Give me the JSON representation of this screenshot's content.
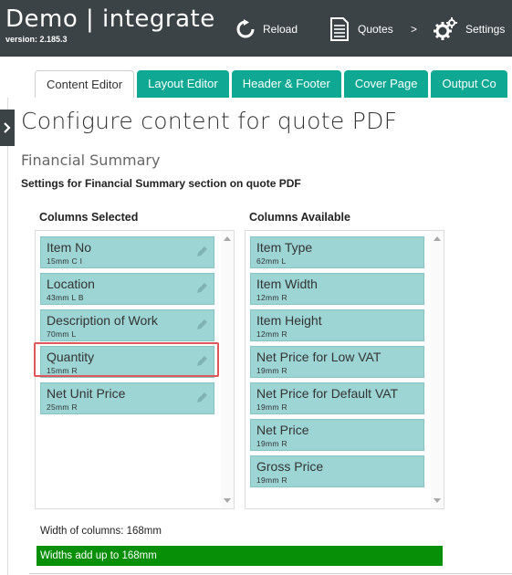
{
  "app": {
    "title": "Demo | integrate",
    "version": "version: 2.185.3"
  },
  "nav": {
    "reload_label": "Reload",
    "reload_icon": "reload-icon",
    "quotes_label": "Quotes",
    "quotes_icon": "document-icon",
    "separator": ">",
    "settings_label": "Settings",
    "settings_icon": "gear-icon"
  },
  "tabs": [
    {
      "label": "Content Editor",
      "active": true
    },
    {
      "label": "Layout Editor",
      "active": false
    },
    {
      "label": "Header & Footer",
      "active": false
    },
    {
      "label": "Cover Page",
      "active": false
    },
    {
      "label": "Output Co",
      "active": false
    }
  ],
  "page": {
    "title": "Configure content for quote PDF",
    "section_title": "Financial Summary",
    "section_desc": "Settings for Financial Summary section on quote PDF"
  },
  "selected": {
    "header": "Columns Selected",
    "items": [
      {
        "name": "Item No",
        "meta": "15mm C I"
      },
      {
        "name": "Location",
        "meta": "43mm L B"
      },
      {
        "name": "Description of Work",
        "meta": "70mm L"
      },
      {
        "name": "Quantity",
        "meta": "15mm R"
      },
      {
        "name": "Net Unit Price",
        "meta": "25mm R"
      }
    ]
  },
  "available": {
    "header": "Columns Available",
    "items": [
      {
        "name": "Item Type",
        "meta": "62mm L"
      },
      {
        "name": "Item Width",
        "meta": "12mm R"
      },
      {
        "name": "Item Height",
        "meta": "12mm R"
      },
      {
        "name": "Net Price for Low VAT",
        "meta": "19mm R"
      },
      {
        "name": "Net Price for Default VAT",
        "meta": "19mm R"
      },
      {
        "name": "Net Price",
        "meta": "19mm R"
      },
      {
        "name": "Gross Price",
        "meta": "19mm R"
      }
    ]
  },
  "footer": {
    "width_label": "Width of columns: 168mm",
    "status_text": "Widths add up to 168mm"
  },
  "colors": {
    "topbar": "#3c4347",
    "tab_inactive": "#0fa892",
    "item_bg": "#9dd5d5",
    "highlight": "#e0575a",
    "status_ok": "#078f07"
  }
}
